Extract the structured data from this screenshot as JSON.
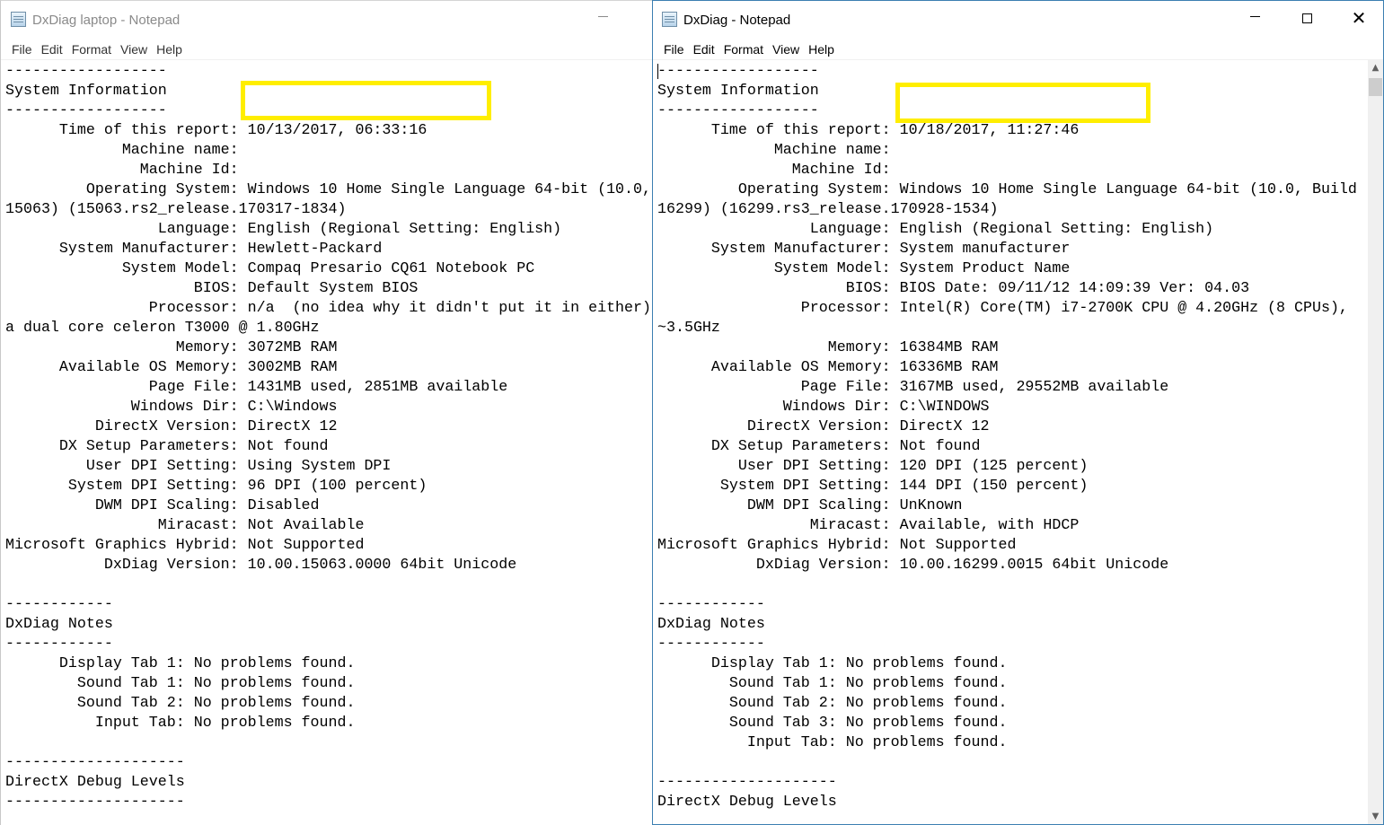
{
  "left_window": {
    "title": "DxDiag laptop - Notepad",
    "controls": {
      "minimize": "—"
    },
    "menu": [
      "File",
      "Edit",
      "Format",
      "View",
      "Help"
    ],
    "lines": [
      "------------------",
      "System Information",
      "------------------",
      "      Time of this report: 10/13/2017, 06:33:16",
      "             Machine name:",
      "               Machine Id:",
      "         Operating System: Windows 10 Home Single Language 64-bit (10.0,",
      "15063) (15063.rs2_release.170317-1834)",
      "                 Language: English (Regional Setting: English)",
      "      System Manufacturer: Hewlett-Packard",
      "             System Model: Compaq Presario CQ61 Notebook PC",
      "                     BIOS: Default System BIOS",
      "                Processor: n/a  (no idea why it didn't put it in either)",
      "a dual core celeron T3000 @ 1.80GHz",
      "                   Memory: 3072MB RAM",
      "      Available OS Memory: 3002MB RAM",
      "                Page File: 1431MB used, 2851MB available",
      "              Windows Dir: C:\\Windows",
      "          DirectX Version: DirectX 12",
      "      DX Setup Parameters: Not found",
      "         User DPI Setting: Using System DPI",
      "       System DPI Setting: 96 DPI (100 percent)",
      "          DWM DPI Scaling: Disabled",
      "                 Miracast: Not Available",
      "Microsoft Graphics Hybrid: Not Supported",
      "           DxDiag Version: 10.00.15063.0000 64bit Unicode",
      "",
      "------------",
      "DxDiag Notes",
      "------------",
      "      Display Tab 1: No problems found.",
      "        Sound Tab 1: No problems found.",
      "        Sound Tab 2: No problems found.",
      "          Input Tab: No problems found.",
      "",
      "--------------------",
      "DirectX Debug Levels",
      "--------------------"
    ]
  },
  "right_window": {
    "title": "DxDiag - Notepad",
    "controls": {
      "minimize": "—",
      "maximize": "☐",
      "close": "✕"
    },
    "menu": [
      "File",
      "Edit",
      "Format",
      "View",
      "Help"
    ],
    "lines": [
      "------------------",
      "System Information",
      "------------------",
      "      Time of this report: 10/18/2017, 11:27:46",
      "             Machine name:",
      "               Machine Id:",
      "         Operating System: Windows 10 Home Single Language 64-bit (10.0, Build",
      "16299) (16299.rs3_release.170928-1534)",
      "                 Language: English (Regional Setting: English)",
      "      System Manufacturer: System manufacturer",
      "             System Model: System Product Name",
      "                     BIOS: BIOS Date: 09/11/12 14:09:39 Ver: 04.03",
      "                Processor: Intel(R) Core(TM) i7-2700K CPU @ 4.20GHz (8 CPUs),",
      "~3.5GHz",
      "                   Memory: 16384MB RAM",
      "      Available OS Memory: 16336MB RAM",
      "                Page File: 3167MB used, 29552MB available",
      "              Windows Dir: C:\\WINDOWS",
      "          DirectX Version: DirectX 12",
      "      DX Setup Parameters: Not found",
      "         User DPI Setting: 120 DPI (125 percent)",
      "       System DPI Setting: 144 DPI (150 percent)",
      "          DWM DPI Scaling: UnKnown",
      "                 Miracast: Available, with HDCP",
      "Microsoft Graphics Hybrid: Not Supported",
      "           DxDiag Version: 10.00.16299.0015 64bit Unicode",
      "",
      "------------",
      "DxDiag Notes",
      "------------",
      "      Display Tab 1: No problems found.",
      "        Sound Tab 1: No problems found.",
      "        Sound Tab 2: No problems found.",
      "        Sound Tab 3: No problems found.",
      "          Input Tab: No problems found.",
      "",
      "--------------------",
      "DirectX Debug Levels"
    ],
    "scrollbar": {
      "up_arrow": "▲",
      "down_arrow": "▼"
    }
  },
  "colors": {
    "redaction_box": "#ffee00",
    "active_border": "#3c7fb1",
    "inactive_title": "#8a8a8a"
  }
}
